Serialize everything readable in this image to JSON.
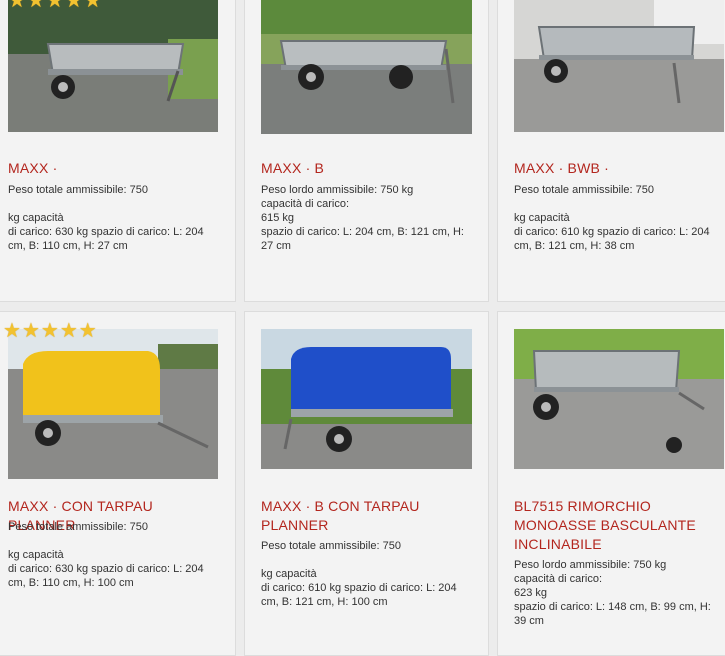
{
  "products": [
    {
      "title_brand": "MAXX",
      "title_rest": " · ",
      "desc": "Peso totale ammissibile: 750\n\nkg capacità\ndi carico: 630 kg spazio di carico: L: 204 cm, B: 110 cm, H: 27 cm",
      "rating": 5,
      "tarp_color": ""
    },
    {
      "title_brand": "MAXX",
      "title_rest": " · B",
      "desc": "Peso lordo ammissibile: 750 kg\ncapacità di carico:\n615 kg\nspazio di carico: L: 204 cm, B: 121 cm, H: 27 cm",
      "rating": 0,
      "tarp_color": ""
    },
    {
      "title_brand": "MAXX",
      "title_rest": " · BWB · ",
      "desc": "Peso totale ammissibile: 750\n\nkg capacità\ndi carico: 610 kg spazio di carico: L: 204 cm, B: 121 cm, H: 38 cm",
      "rating": 0,
      "tarp_color": ""
    },
    {
      "title_brand": "MAXX",
      "title_rest": " · CON TARPAU PLANNER",
      "desc": "Peso totale ammissibile: 750\n\nkg capacità\ndi carico: 630 kg spazio di carico: L: 204 cm, B: 110 cm, H: 100 cm",
      "rating": 5,
      "tarp_color": "#f1c21b"
    },
    {
      "title_brand": "MAXX",
      "title_rest": " · B CON TARPAU PLANNER",
      "desc": "Peso totale ammissibile: 750\n\nkg capacità\ndi carico: 610 kg spazio di carico: L: 204 cm, B: 121 cm, H: 100 cm",
      "rating": 0,
      "tarp_color": "#1f4fc9"
    },
    {
      "title_brand": "BL7515",
      "title_rest": " RIMORCHIO MONOASSE BASCULANTE INCLINABILE",
      "desc": "Peso lordo ammissibile: 750 kg\ncapacità di carico:\n623 kg\nspazio di carico: L: 148 cm, B: 99 cm, H: 39 cm",
      "rating": 0,
      "tarp_color": ""
    }
  ],
  "icons": {
    "star": "star-icon",
    "trailer": "trailer-photo"
  },
  "colors": {
    "title": "#b3261e",
    "star": "#f2c230"
  }
}
